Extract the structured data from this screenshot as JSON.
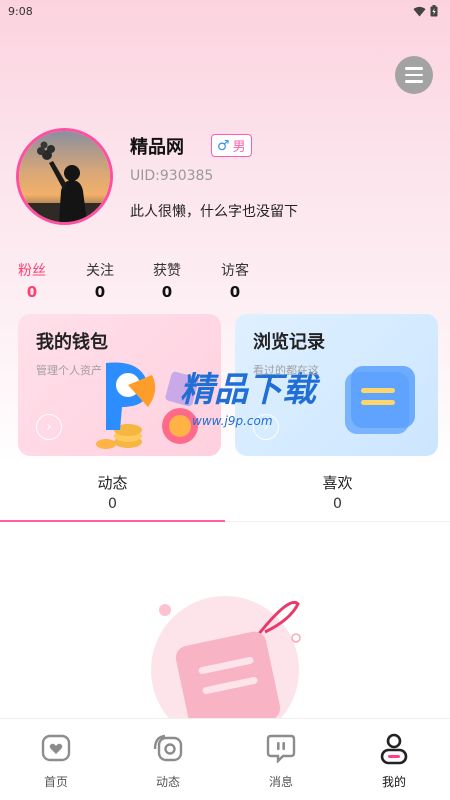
{
  "status_bar": {
    "time": "9:08"
  },
  "profile": {
    "username": "精品网",
    "gender": "男",
    "uid": "UID:930385",
    "bio": "此人很懒，什么字也没留下"
  },
  "stats": [
    {
      "label": "粉丝",
      "value": "0"
    },
    {
      "label": "关注",
      "value": "0"
    },
    {
      "label": "获赞",
      "value": "0"
    },
    {
      "label": "访客",
      "value": "0"
    }
  ],
  "cards": {
    "wallet": {
      "title": "我的钱包",
      "subtitle": "管理个人资产"
    },
    "history": {
      "title": "浏览记录",
      "subtitle": "看过的都在这"
    }
  },
  "content_tabs": [
    {
      "label": "动态",
      "count": "0"
    },
    {
      "label": "喜欢",
      "count": "0"
    }
  ],
  "watermark": {
    "text": "精品下载",
    "url": "www.j9p.com"
  },
  "bottom_nav": [
    {
      "label": "首页",
      "icon": "home-heart-icon"
    },
    {
      "label": "动态",
      "icon": "moments-icon"
    },
    {
      "label": "消息",
      "icon": "message-icon"
    },
    {
      "label": "我的",
      "icon": "profile-icon"
    }
  ],
  "colors": {
    "accent": "#ff5fa8",
    "active_stat": "#ff3f6f"
  }
}
